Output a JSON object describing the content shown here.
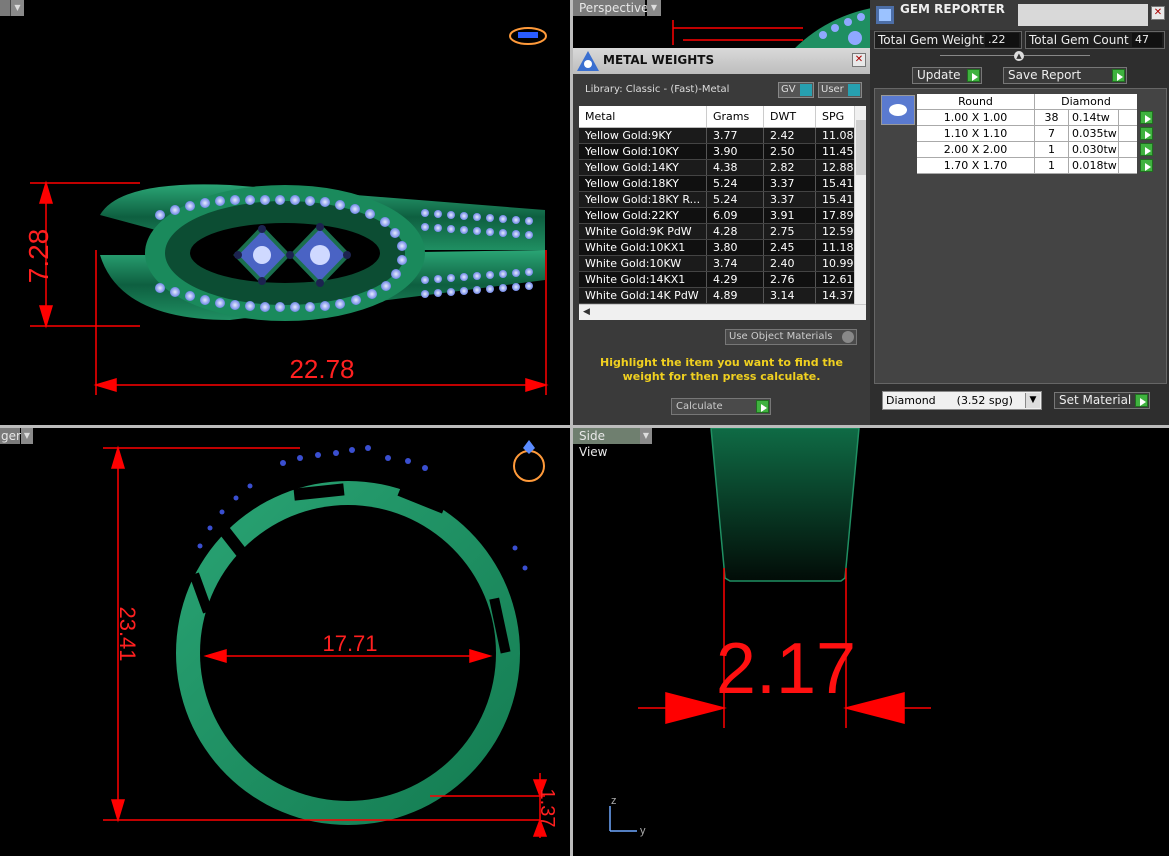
{
  "viewports": {
    "top_left": {
      "label": "",
      "dims": {
        "height": "7.28",
        "width": "22.78"
      }
    },
    "top_right": {
      "label": "Perspective"
    },
    "bottom_left": {
      "label": "ger",
      "dims": {
        "height": "23.41",
        "inner": "17.71",
        "thickness": "1.37"
      }
    },
    "bottom_right": {
      "label": "Side View",
      "dims": {
        "width": "2.17"
      },
      "axis_z": "z",
      "axis_y": "y"
    }
  },
  "metal_weights": {
    "title": "METAL WEIGHTS",
    "library": "Library: Classic - (Fast)-Metal",
    "gv_label": "GV",
    "user_label": "User",
    "columns": [
      "Metal",
      "Grams",
      "DWT",
      "SPG"
    ],
    "rows": [
      [
        "Yellow Gold:9KY",
        "3.77",
        "2.42",
        "11.08"
      ],
      [
        "Yellow Gold:10KY",
        "3.90",
        "2.50",
        "11.45"
      ],
      [
        "Yellow Gold:14KY",
        "4.38",
        "2.82",
        "12.88"
      ],
      [
        "Yellow Gold:18KY",
        "5.24",
        "3.37",
        "15.41"
      ],
      [
        "Yellow Gold:18KY R...",
        "5.24",
        "3.37",
        "15.41"
      ],
      [
        "Yellow Gold:22KY",
        "6.09",
        "3.91",
        "17.89"
      ],
      [
        "White Gold:9K PdW",
        "4.28",
        "2.75",
        "12.59"
      ],
      [
        "White Gold:10KX1",
        "3.80",
        "2.45",
        "11.18"
      ],
      [
        "White Gold:10KW",
        "3.74",
        "2.40",
        "10.99"
      ],
      [
        "White Gold:14KX1",
        "4.29",
        "2.76",
        "12.61"
      ],
      [
        "White Gold:14K PdW",
        "4.89",
        "3.14",
        "14.37"
      ]
    ],
    "use_object_materials": "Use Object Materials",
    "hint": "Highlight the item you want to find the weight for then press calculate.",
    "calculate": "Calculate"
  },
  "gem_reporter": {
    "title": "GEM REPORTER",
    "total_weight_label": "Total Gem Weight",
    "total_weight_value": ".22",
    "total_count_label": "Total Gem Count",
    "total_count_value": "47",
    "update": "Update",
    "save_report": "Save Report",
    "columns": [
      "Round",
      "Diamond"
    ],
    "rows": [
      [
        "1.00 X 1.00",
        "38",
        "0.14tw"
      ],
      [
        "1.10 X 1.10",
        "7",
        "0.035tw"
      ],
      [
        "2.00 X 2.00",
        "1",
        "0.030tw"
      ],
      [
        "1.70 X 1.70",
        "1",
        "0.018tw"
      ]
    ],
    "material_select": "Diamond      (3.52 spg)",
    "set_material": "Set Material"
  },
  "colors": {
    "ring": "#1f8f62",
    "dimension": "#ff0000",
    "gem": "#8fa8ff",
    "panel": "#3a3a3a",
    "hint": "#f0d020"
  }
}
